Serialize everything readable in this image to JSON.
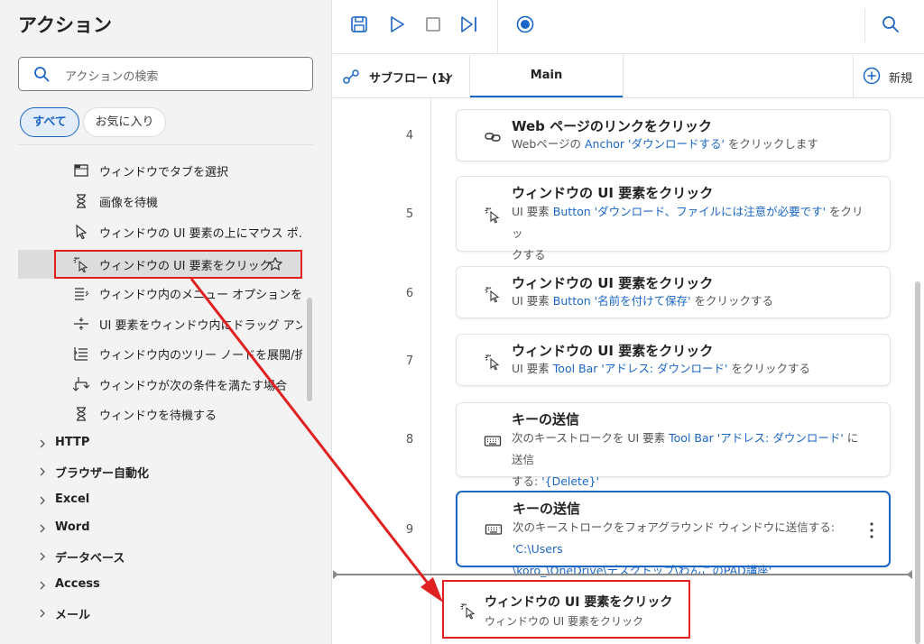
{
  "left_panel": {
    "title": "アクション",
    "search_placeholder": "アクションの検索",
    "filters": {
      "all": "すべて",
      "favorites": "お気に入り"
    },
    "items": [
      {
        "label": "ウィンドウでタブを選択",
        "icon": "tab-window-icon"
      },
      {
        "label": "画像を待機",
        "icon": "hourglass-icon"
      },
      {
        "label": "ウィンドウの UI 要素の上にマウス ポ…",
        "icon": "mouse-pointer-icon"
      },
      {
        "label": "ウィンドウの UI 要素をクリック",
        "icon": "click-cursor-icon",
        "selected": true
      },
      {
        "label": "ウィンドウ内のメニュー オプションを選択",
        "icon": "menu-list-icon"
      },
      {
        "label": "UI 要素をウィンドウ内にドラッグ アン…",
        "icon": "drag-drop-icon"
      },
      {
        "label": "ウィンドウ内のツリー ノードを展開/折…",
        "icon": "tree-node-icon"
      },
      {
        "label": "ウィンドウが次の条件を満たす場合",
        "icon": "branch-if-icon"
      },
      {
        "label": "ウィンドウを待機する",
        "icon": "hourglass-icon"
      }
    ],
    "categories": [
      "HTTP",
      "ブラウザー自動化",
      "Excel",
      "Word",
      "データベース",
      "Access",
      "メール"
    ]
  },
  "toolbar": {
    "buttons": [
      "save-icon",
      "run-icon",
      "stop-icon",
      "step-icon",
      "record-icon",
      "search-icon"
    ]
  },
  "tabs": {
    "subflow_label": "サブフロー (1)",
    "main_label": "Main",
    "new_label": "新規"
  },
  "flow": {
    "steps": [
      {
        "number": "4",
        "icon": "link-icon",
        "title": "Web ページのリンクをクリック",
        "desc_lines": [
          [
            {
              "t": "Webページの "
            },
            {
              "t": "Anchor 'ダウンロードする'",
              "p": true
            },
            {
              "t": " をクリックします"
            }
          ]
        ]
      },
      {
        "number": "5",
        "icon": "click-cursor-icon",
        "title": "ウィンドウの UI 要素をクリック",
        "desc_lines": [
          [
            {
              "t": "UI 要素 "
            },
            {
              "t": "Button 'ダウンロード、ファイルには注意が必要です'",
              "p": true
            },
            {
              "t": " をクリッ"
            }
          ],
          [
            {
              "t": "クする"
            }
          ]
        ]
      },
      {
        "number": "6",
        "icon": "click-cursor-icon",
        "title": "ウィンドウの UI 要素をクリック",
        "desc_lines": [
          [
            {
              "t": "UI 要素 "
            },
            {
              "t": "Button '名前を付けて保存'",
              "p": true
            },
            {
              "t": " をクリックする"
            }
          ]
        ]
      },
      {
        "number": "7",
        "icon": "click-cursor-icon",
        "title": "ウィンドウの UI 要素をクリック",
        "desc_lines": [
          [
            {
              "t": "UI 要素 "
            },
            {
              "t": "Tool Bar 'アドレス: ダウンロード'",
              "p": true
            },
            {
              "t": " をクリックする"
            }
          ]
        ]
      },
      {
        "number": "8",
        "icon": "keyboard-icon",
        "title": "キーの送信",
        "desc_lines": [
          [
            {
              "t": "次のキーストロークを UI 要素 "
            },
            {
              "t": "Tool Bar 'アドレス: ダウンロード'",
              "p": true
            },
            {
              "t": " に送信"
            }
          ],
          [
            {
              "t": "する: "
            },
            {
              "t": "'{Delete}'",
              "p": true
            }
          ]
        ]
      },
      {
        "number": "9",
        "icon": "keyboard-icon",
        "title": "キーの送信",
        "selected": true,
        "desc_lines": [
          [
            {
              "t": "次のキーストロークをフォアグラウンド ウィンドウに送信する: "
            },
            {
              "t": "'C:\\Users",
              "p": true
            }
          ],
          [
            {
              "t": "\\koro_\\OneDrive\\デスクトップ\\わんこのPAD講座'",
              "p": true
            }
          ]
        ]
      }
    ],
    "dragged": {
      "title": "ウィンドウの UI 要素をクリック",
      "desc": "ウィンドウの UI 要素をクリック"
    }
  },
  "colors": {
    "accent": "#1a66c6",
    "highlight": "#e02020"
  }
}
